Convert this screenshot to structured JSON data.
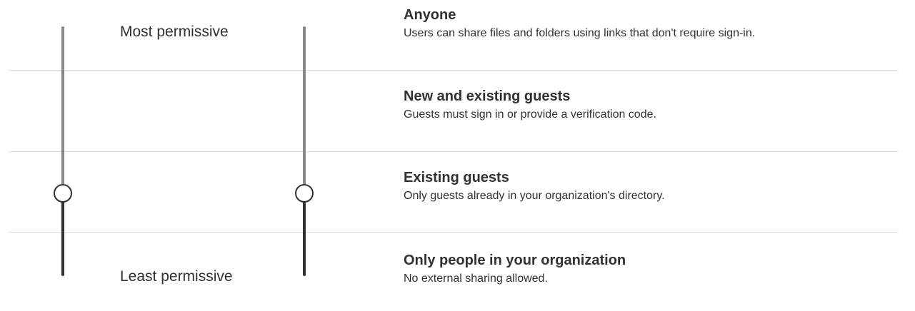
{
  "scale": {
    "most_label": "Most permissive",
    "least_label": "Least permissive"
  },
  "sliders": [
    {
      "name": "left-slider",
      "selected_level": "Existing guests",
      "selected_index": 2
    },
    {
      "name": "right-slider",
      "selected_level": "Existing guests",
      "selected_index": 2
    }
  ],
  "options": [
    {
      "title": "Anyone",
      "description": "Users can share files and folders using links that don't require sign-in."
    },
    {
      "title": "New and existing guests",
      "description": "Guests must sign in or provide a verification code."
    },
    {
      "title": "Existing guests",
      "description": "Only guests already in your organization's directory."
    },
    {
      "title": "Only people in your organization",
      "description": "No external sharing allowed."
    }
  ],
  "colors": {
    "track_upper": "#8a8886",
    "track_lower": "#323130",
    "divider": "#e1dfdd",
    "text": "#323130"
  }
}
